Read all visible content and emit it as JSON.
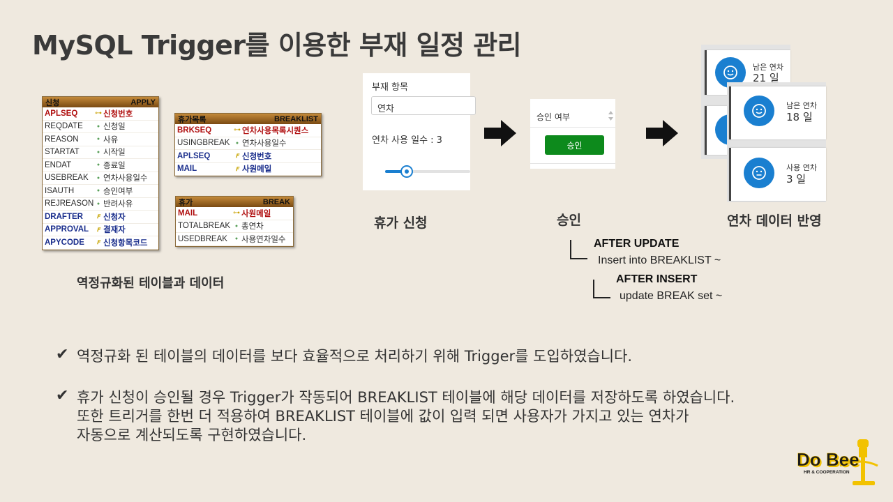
{
  "title": "MySQL Trigger를 이용한 부재 일정 관리",
  "tables": {
    "apply": {
      "name_kr": "신청",
      "name": "APPLY",
      "rows": [
        {
          "col": "APLSEQ",
          "kor": "신청번호",
          "type": "pk"
        },
        {
          "col": "REQDATE",
          "kor": "신청일",
          "type": "attr"
        },
        {
          "col": "REASON",
          "kor": "사유",
          "type": "attr"
        },
        {
          "col": "STARTAT",
          "kor": "시작일",
          "type": "attr"
        },
        {
          "col": "ENDAT",
          "kor": "종료일",
          "type": "attr"
        },
        {
          "col": "USEBREAK",
          "kor": "연차사용일수",
          "type": "attr"
        },
        {
          "col": "ISAUTH",
          "kor": "승인여부",
          "type": "attr"
        },
        {
          "col": "REJREASON",
          "kor": "반려사유",
          "type": "attr"
        },
        {
          "col": "DRAFTER",
          "kor": "신청자",
          "type": "fk"
        },
        {
          "col": "APPROVAL",
          "kor": "결재자",
          "type": "fk"
        },
        {
          "col": "APYCODE",
          "kor": "신청항목코드",
          "type": "fk"
        }
      ]
    },
    "breaklist": {
      "name_kr": "휴가목록",
      "name": "BREAKLIST",
      "rows": [
        {
          "col": "BRKSEQ",
          "kor": "연차사용목록시퀀스",
          "type": "pk"
        },
        {
          "col": "USINGBREAK",
          "kor": "연차사용일수",
          "type": "attr"
        },
        {
          "col": "APLSEQ",
          "kor": "신청번호",
          "type": "fk"
        },
        {
          "col": "MAIL",
          "kor": "사원메일",
          "type": "fk"
        }
      ]
    },
    "break": {
      "name_kr": "휴가",
      "name": "BREAK",
      "rows": [
        {
          "col": "MAIL",
          "kor": "사원메일",
          "type": "pkfk"
        },
        {
          "col": "TOTALBREAK",
          "kor": "총연차",
          "type": "attr"
        },
        {
          "col": "USEDBREAK",
          "kor": "사용연차일수",
          "type": "attr"
        }
      ]
    }
  },
  "erd_caption": "역정규화된 테이블과 데이터",
  "apply_form": {
    "field_label": "부재 항목",
    "select_value": "연차",
    "days_label": "연차 사용 일수 : 3",
    "slider_fraction": 0.25
  },
  "approval_form": {
    "label": "승인 여부",
    "button": "승인"
  },
  "cards": {
    "back": {
      "label": "남은 연차",
      "value": "21 일"
    },
    "front_top": {
      "label": "남은 연차",
      "value": "18 일"
    },
    "front_bottom": {
      "label": "사용 연차",
      "value": "3 일"
    }
  },
  "captions": {
    "apply": "휴가 신청",
    "approve": "승인",
    "reflect": "연차 데이터 반영"
  },
  "triggers": [
    {
      "title": "AFTER UPDATE",
      "text": "Insert into BREAKLIST ~"
    },
    {
      "title": "AFTER INSERT",
      "text": "update BREAK set ~"
    }
  ],
  "bullets": [
    "역정규화 된 테이블의 데이터를 보다 효율적으로 처리하기 위해 Trigger를 도입하였습니다.",
    "휴가 신청이 승인될 경우 Trigger가 작동되어 BREAKLIST 테이블에 해당 데이터를 저장하도록 하였습니다.\n또한 트리거를 한번 더 적용하여 BREAKLIST 테이블에 값이 입력 되면 사용자가 가지고 있는 연차가\n자동으로 계산되도록 구현하였습니다."
  ],
  "logo": {
    "text": "Do Bee",
    "sub": "HR & COOPERATION"
  },
  "colors": {
    "background": "#efe9df",
    "accent_blue": "#1a7fd0",
    "approve_green": "#0d8a1c",
    "logo_yellow": "#f2c200"
  }
}
